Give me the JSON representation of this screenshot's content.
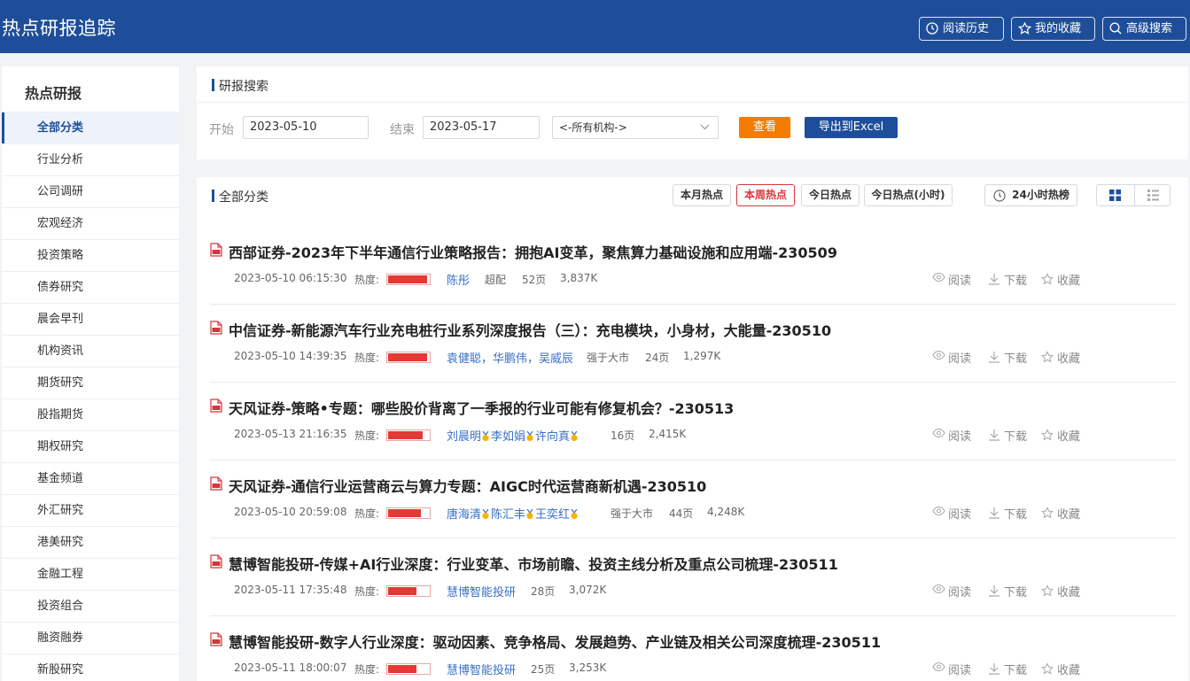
{
  "header": {
    "title": "热点研报追踪",
    "history_label": "阅读历史",
    "favorites_label": "我的收藏",
    "advanced_search_label": "高级搜索"
  },
  "sidebar": {
    "title": "热点研报",
    "items": [
      {
        "label": "全部分类",
        "active": true
      },
      {
        "label": "行业分析"
      },
      {
        "label": "公司调研"
      },
      {
        "label": "宏观经济"
      },
      {
        "label": "投资策略"
      },
      {
        "label": "债券研究"
      },
      {
        "label": "晨会早刊"
      },
      {
        "label": "机构资讯"
      },
      {
        "label": "期货研究"
      },
      {
        "label": "股指期货"
      },
      {
        "label": "期权研究"
      },
      {
        "label": "基金频道"
      },
      {
        "label": "外汇研究"
      },
      {
        "label": "港美研究"
      },
      {
        "label": "金融工程"
      },
      {
        "label": "投资组合"
      },
      {
        "label": "融资融券"
      },
      {
        "label": "新股研究"
      }
    ]
  },
  "search": {
    "title": "研报搜索",
    "start_label": "开始",
    "start_value": "2023-05-10",
    "end_label": "结束",
    "end_value": "2023-05-17",
    "org_select": "<-所有机构->",
    "query_button": "查看",
    "export_button": "导出到Excel"
  },
  "list": {
    "title": "全部分类",
    "filters": {
      "month": "本月热点",
      "week": "本周热点",
      "today": "今日热点",
      "hour": "今日热点(小时)",
      "rank24": "24小时热榜"
    },
    "heat_label": "热度:",
    "actions": {
      "read": "阅读",
      "download": "下载",
      "favorite": "收藏"
    },
    "reports": [
      {
        "title": "西部证券-2023年下半年通信行业策略报告：拥抱AI变革，聚焦算力基础设施和应用端-230509",
        "date": "2023-05-10 06:15:30",
        "heat": 0.95,
        "authors": [
          {
            "name": "陈彤",
            "medal": false
          }
        ],
        "rating": "超配",
        "pages": "52页",
        "size": "3,837K"
      },
      {
        "title": "中信证券-新能源汽车行业充电桩行业系列深度报告（三）：充电模块，小身材，大能量-230510",
        "date": "2023-05-10 14:39:35",
        "heat": 0.95,
        "authors": [
          {
            "name": "袁健聪，华鹏伟，吴威辰",
            "medal": false
          }
        ],
        "rating": "强于大市",
        "pages": "24页",
        "size": "1,297K"
      },
      {
        "title": "天风证券-策略•专题：哪些股价背离了一季报的行业可能有修复机会？-230513",
        "date": "2023-05-13 21:16:35",
        "heat": 0.85,
        "authors": [
          {
            "name": "刘晨明",
            "medal": true
          },
          {
            "name": "李如娟",
            "medal": true
          },
          {
            "name": "许向真",
            "medal": true
          }
        ],
        "rating": "",
        "pages": "16页",
        "size": "2,415K"
      },
      {
        "title": "天风证券-通信行业运营商云与算力专题：AIGC时代运营商新机遇-230510",
        "date": "2023-05-10 20:59:08",
        "heat": 0.8,
        "authors": [
          {
            "name": "唐海清",
            "medal": true
          },
          {
            "name": "陈汇丰",
            "medal": true
          },
          {
            "name": "王奕红",
            "medal": true
          }
        ],
        "rating": "强于大市",
        "pages": "44页",
        "size": "4,248K"
      },
      {
        "title": "慧博智能投研-传媒+AI行业深度：行业变革、市场前瞻、投资主线分析及重点公司梳理-230511",
        "date": "2023-05-11 17:35:48",
        "heat": 0.7,
        "authors": [
          {
            "name": "慧博智能投研",
            "medal": false
          }
        ],
        "rating": "",
        "pages": "28页",
        "size": "3,072K"
      },
      {
        "title": "慧博智能投研-数字人行业深度：驱动因素、竞争格局、发展趋势、产业链及相关公司深度梳理-230511",
        "date": "2023-05-11 18:00:07",
        "heat": 0.7,
        "authors": [
          {
            "name": "慧博智能投研",
            "medal": false
          }
        ],
        "rating": "",
        "pages": "25页",
        "size": "3,253K"
      }
    ]
  },
  "colors": {
    "brand": "#1e4e9a",
    "accent_orange": "#f57c00",
    "heat_red": "#e53935",
    "author_link": "#3a6fc4"
  }
}
